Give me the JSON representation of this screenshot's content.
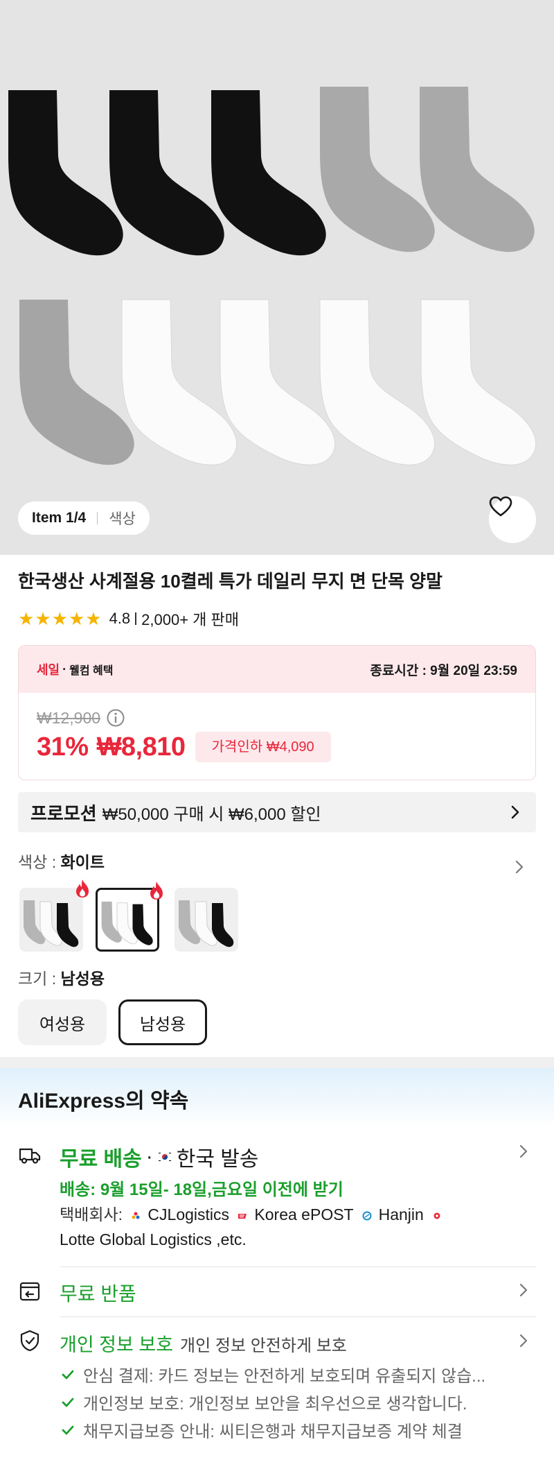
{
  "gallery": {
    "item_index": "Item 1/4",
    "attribute": "색상"
  },
  "product": {
    "title": "한국생산 사계절용 10켤레 특가 데일리 무지 면 단목 양말",
    "rating": "4.8",
    "sold": "2,000+ 개 판매"
  },
  "sale": {
    "label": "세일",
    "dot": "·",
    "welcome": "웰컴 혜택",
    "end_time": "종료시간 : 9월 20일 23:59",
    "original_price": "₩12,900",
    "discount": "31%",
    "price": "₩8,810",
    "price_drop": "가격인하 ₩4,090"
  },
  "promotion": {
    "label": "프로모션",
    "text": "₩50,000 구매 시 ₩6,000 할인"
  },
  "color": {
    "label": "색상 : ",
    "value": "화이트",
    "options": [
      {
        "id": "gray-white-black",
        "hot": true,
        "selected": false
      },
      {
        "id": "gray-white-black-2",
        "hot": true,
        "selected": true
      },
      {
        "id": "gray-white-black-3",
        "hot": false,
        "selected": false
      }
    ]
  },
  "size": {
    "label": "크기 : ",
    "value": "남성용",
    "options": [
      "여성용",
      "남성용"
    ]
  },
  "promise": {
    "title": "AliExpress의 약속",
    "shipping": {
      "free": "무료 배송",
      "dot": "·",
      "from": "한국 발송",
      "delivery": "배송: 9월 15일- 18일,금요일 이전에 받기",
      "carrier_label": "택배회사:",
      "carriers": [
        "CJLogistics",
        "Korea ePOST",
        "Hanjin",
        "Lotte Global Logistics ,etc."
      ]
    },
    "returns": "무료 반품",
    "privacy": {
      "title": "개인 정보 보호",
      "subtitle": "개인 정보 안전하게 보호",
      "items": [
        "안심 결제: 카드 정보는 안전하게 보호되며 유출되지 않습...",
        "개인정보 보호: 개인정보 보안을 최우선으로 생각합니다.",
        "채무지급보증 안내: 씨티은행과 채무지급보증 계약 체결"
      ]
    }
  }
}
